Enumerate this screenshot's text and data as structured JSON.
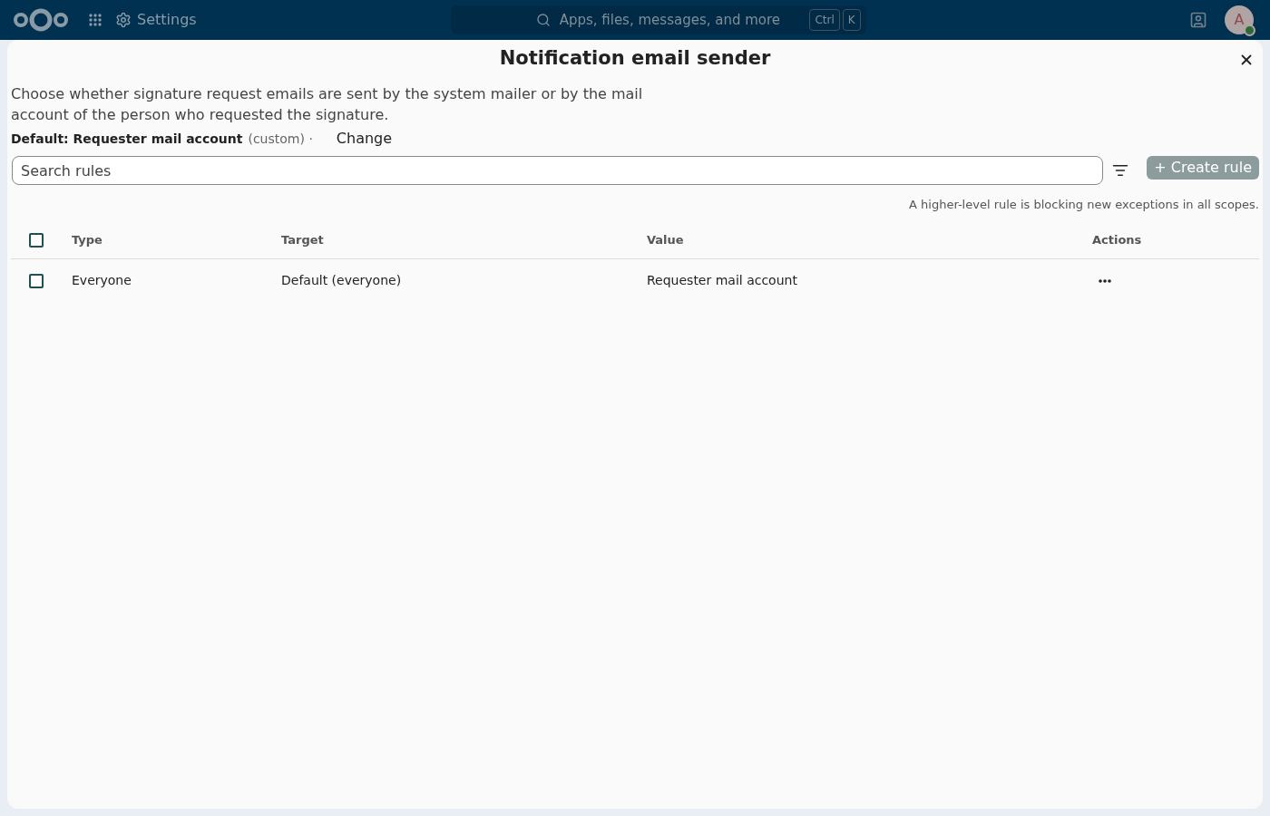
{
  "header": {
    "app_title": "Settings",
    "search_placeholder": "Apps, files, messages, and more",
    "shortcut_keys": [
      "Ctrl",
      "K"
    ],
    "avatar_initial": "A"
  },
  "dialog": {
    "title": "Notification email sender",
    "description": "Choose whether signature request emails are sent by the system mailer or by the mail account of the person who requested the signature.",
    "default_text": "Default: Requester mail account",
    "default_note": "(custom) ·",
    "change_button": "Change",
    "search_placeholder": "Search rules",
    "create_button": "+ Create rule",
    "notice": "A higher-level rule is blocking new exceptions in all scopes.",
    "table": {
      "columns": [
        "Type",
        "Target",
        "Value",
        "Actions"
      ],
      "all_checked": false,
      "rows": [
        {
          "checked": false,
          "type": "Everyone",
          "target": "Default (everyone)",
          "value": "Requester mail account"
        }
      ]
    }
  }
}
